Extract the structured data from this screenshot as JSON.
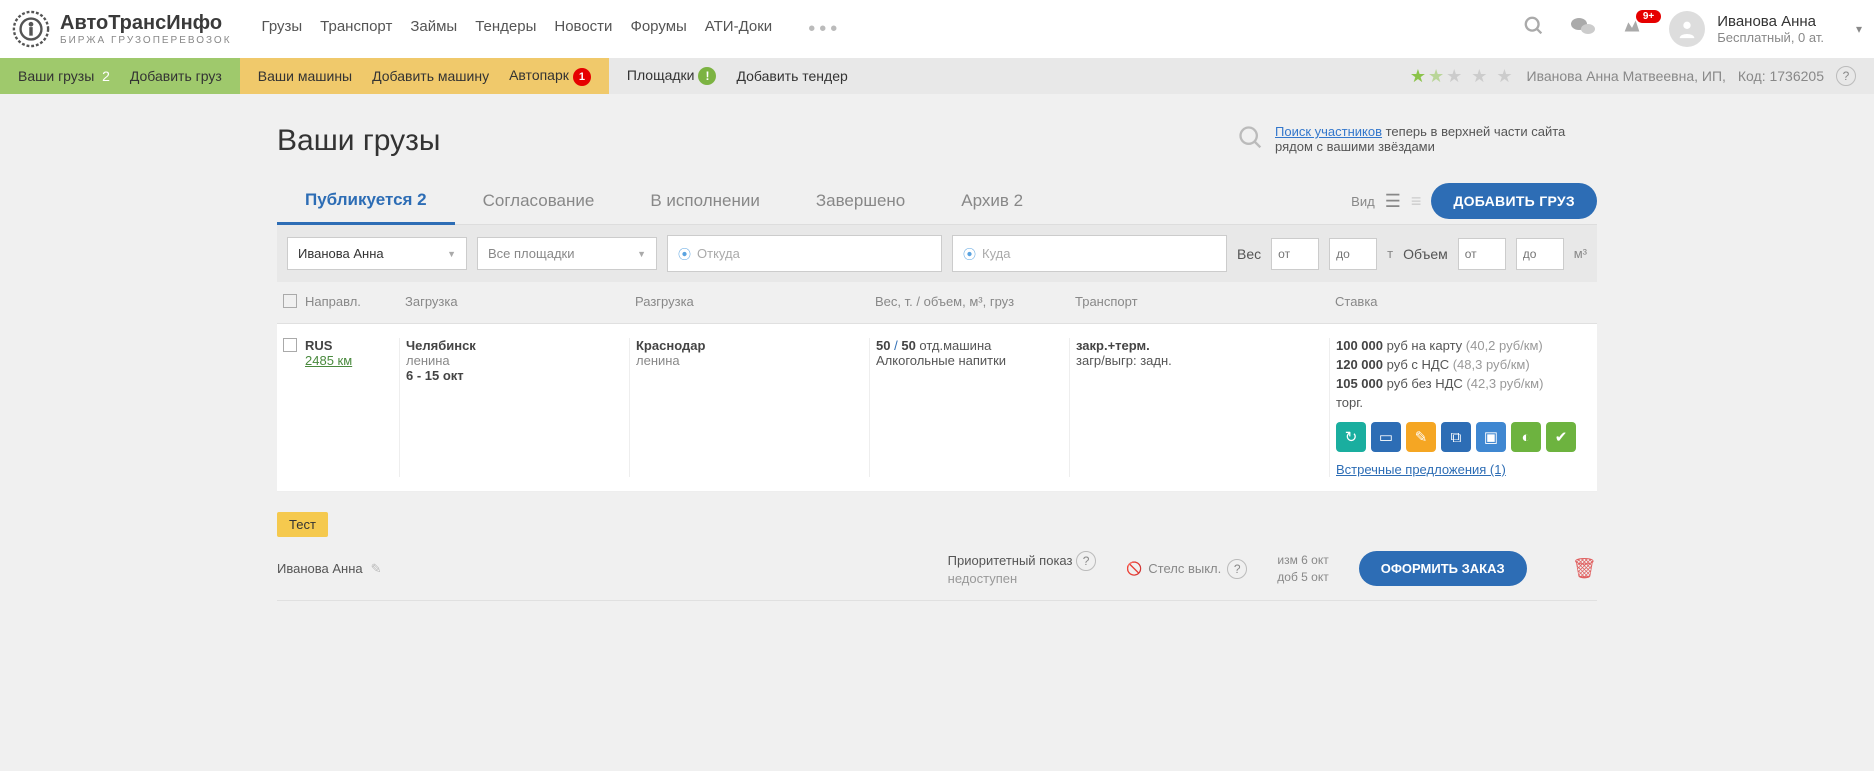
{
  "header": {
    "logo_title": "АвтоТрансИнфо",
    "logo_sub": "БИРЖА ГРУЗОПЕРЕВОЗОК",
    "nav": [
      "Грузы",
      "Транспорт",
      "Займы",
      "Тендеры",
      "Новости",
      "Форумы",
      "АТИ-Доки"
    ],
    "badge": "9+",
    "user_name": "Иванова Анна",
    "user_status": "Бесплатный, 0 ат."
  },
  "subheader": {
    "your_cargo": "Ваши грузы",
    "your_cargo_count": "2",
    "add_cargo": "Добавить груз",
    "your_vehicles": "Ваши машины",
    "add_vehicle": "Добавить машину",
    "autopark": "Автопарк",
    "autopark_badge": "1",
    "platforms": "Площадки",
    "platforms_badge": "!",
    "add_tender": "Добавить тендер",
    "company": "Иванова Анна Матвеевна, ИП,",
    "code": "Код: 1736205"
  },
  "page": {
    "title": "Ваши грузы",
    "hint_link": "Поиск участников",
    "hint_text": " теперь в верхней части сайта рядом с вашими звёздами"
  },
  "tabs": {
    "t1": "Публикуется 2",
    "t2": "Согласование",
    "t3": "В исполнении",
    "t4": "Завершено",
    "t5": "Архив 2",
    "view": "Вид",
    "add_btn": "ДОБАВИТЬ ГРУЗ"
  },
  "filters": {
    "user": "Иванова Анна",
    "platforms": "Все площадки",
    "from_ph": "Откуда",
    "to_ph": "Куда",
    "weight": "Вес",
    "from": "от",
    "to": "до",
    "t": "т",
    "volume": "Объем",
    "m3": "м³"
  },
  "thead": {
    "dir": "Направл.",
    "load": "Загрузка",
    "unload": "Разгрузка",
    "weight": "Вес, т. / объем, м³, груз",
    "transport": "Транспорт",
    "rate": "Ставка"
  },
  "row": {
    "country": "RUS",
    "distance": "2485 км",
    "load_city": "Челябинск",
    "load_street": "ленина",
    "load_dates": "6 - 15 окт",
    "unload_city": "Краснодар",
    "unload_street": "ленина",
    "weight_a": "50",
    "weight_b": "50",
    "weight_tail": " отд.машина",
    "cargo": "Алкогольные напитки",
    "transport1": "закр.+терм.",
    "transport2": "загр/выгр: задн.",
    "rate1_a": "100 000",
    "rate1_b": " руб на карту ",
    "rate1_c": "(40,2 руб/км)",
    "rate2_a": "120 000",
    "rate2_b": " руб с НДС ",
    "rate2_c": "(48,3 руб/км)",
    "rate3_a": "105 000",
    "rate3_b": " руб без НДС ",
    "rate3_c": "(42,3 руб/км)",
    "torg": "торг.",
    "counter": "Встречные предложения (1)"
  },
  "bottom": {
    "test": "Тест",
    "owner": "Иванова Анна",
    "priority_t": "Приоритетный показ",
    "priority_s": "недоступен",
    "stealth": "Стелс выкл.",
    "date1": "изм 6 окт",
    "date2": "доб 5 окт",
    "order": "ОФОРМИТЬ ЗАКАЗ"
  }
}
